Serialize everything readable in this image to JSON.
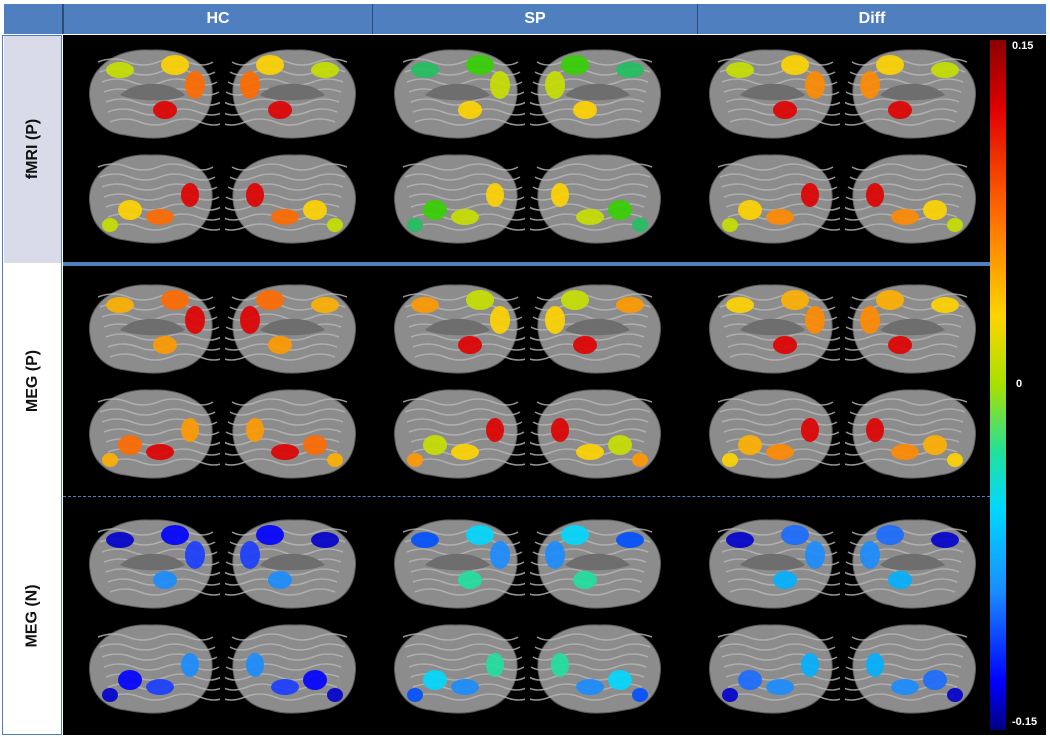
{
  "columns": [
    "HC",
    "SP",
    "Diff"
  ],
  "rows": [
    "fMRI (P)",
    "MEG (P)",
    "MEG (N)"
  ],
  "colorbar": {
    "max": "0.15",
    "mid": "0",
    "min": "-0.15"
  },
  "colors": {
    "header_bg": "#4f7fbf",
    "row1_label_bg": "#d9dce8",
    "brain_gray": "#8c8c8c",
    "background": "#000000"
  },
  "panels": [
    {
      "row": "fMRI (P)",
      "col": "HC",
      "blob_colors": [
        "#ffd400",
        "#ff6a00",
        "#e00000",
        "#c8e000"
      ]
    },
    {
      "row": "fMRI (P)",
      "col": "SP",
      "blob_colors": [
        "#35d000",
        "#c8e000",
        "#ffd400",
        "#20c060"
      ]
    },
    {
      "row": "fMRI (P)",
      "col": "Diff",
      "blob_colors": [
        "#ffd400",
        "#ff8a00",
        "#e00000",
        "#c8e000"
      ]
    },
    {
      "row": "MEG (P)",
      "col": "HC",
      "blob_colors": [
        "#ff6a00",
        "#e00000",
        "#ff9a00",
        "#ffb000"
      ]
    },
    {
      "row": "MEG (P)",
      "col": "SP",
      "blob_colors": [
        "#c8e000",
        "#ffd400",
        "#e00000",
        "#ff9a00"
      ]
    },
    {
      "row": "MEG (P)",
      "col": "Diff",
      "blob_colors": [
        "#ffb000",
        "#ff8a00",
        "#e00000",
        "#ffd400"
      ]
    },
    {
      "row": "MEG (N)",
      "col": "HC",
      "blob_colors": [
        "#0000ff",
        "#1a3cff",
        "#1a8cff",
        "#0000cc"
      ]
    },
    {
      "row": "MEG (N)",
      "col": "SP",
      "blob_colors": [
        "#00d8ff",
        "#1a8cff",
        "#20e0a0",
        "#0050ff"
      ]
    },
    {
      "row": "MEG (N)",
      "col": "Diff",
      "blob_colors": [
        "#1a6cff",
        "#1a8cff",
        "#00b0ff",
        "#0000cc"
      ]
    }
  ]
}
